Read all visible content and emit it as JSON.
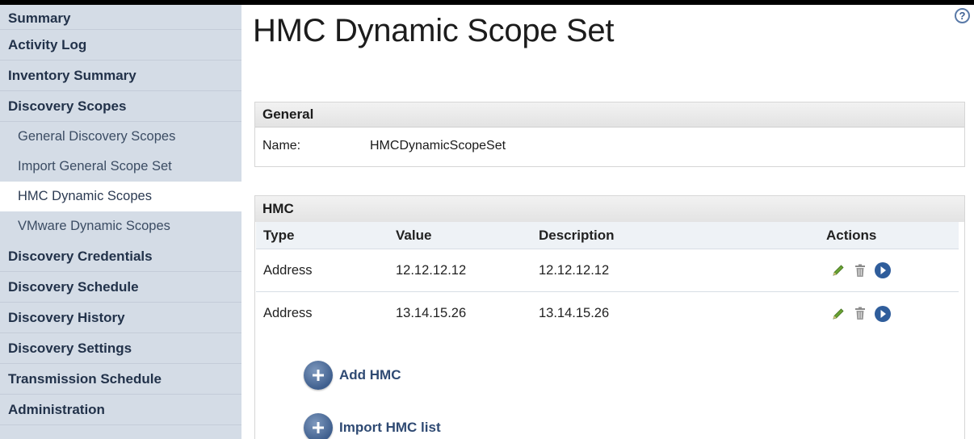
{
  "sidebar": {
    "items": [
      {
        "label": "Summary",
        "type": "section"
      },
      {
        "label": "Activity Log",
        "type": "section"
      },
      {
        "label": "Inventory Summary",
        "type": "section"
      },
      {
        "label": "Discovery Scopes",
        "type": "section"
      },
      {
        "label": "General Discovery Scopes",
        "type": "sub"
      },
      {
        "label": "Import General Scope Set",
        "type": "sub"
      },
      {
        "label": "HMC Dynamic Scopes",
        "type": "sub",
        "active": true
      },
      {
        "label": "VMware Dynamic Scopes",
        "type": "sub"
      },
      {
        "label": "Discovery Credentials",
        "type": "section"
      },
      {
        "label": "Discovery Schedule",
        "type": "section"
      },
      {
        "label": "Discovery History",
        "type": "section"
      },
      {
        "label": "Discovery Settings",
        "type": "section"
      },
      {
        "label": "Transmission Schedule",
        "type": "section"
      },
      {
        "label": "Administration",
        "type": "section"
      }
    ]
  },
  "header": {
    "title": "HMC Dynamic Scope Set",
    "help_icon": "question-circle-icon",
    "help_glyph": "?"
  },
  "general": {
    "heading": "General",
    "name_label": "Name:",
    "name_value": "HMCDynamicScopeSet"
  },
  "hmc": {
    "heading": "HMC",
    "columns": [
      "Type",
      "Value",
      "Description",
      "Actions"
    ],
    "rows": [
      {
        "type": "Address",
        "value": "12.12.12.12",
        "description": "12.12.12.12"
      },
      {
        "type": "Address",
        "value": "13.14.15.26",
        "description": "13.14.15.26"
      }
    ],
    "row_actions": [
      "pencil-icon",
      "trash-icon",
      "arrow-circle-right-icon"
    ],
    "add_label": "Add HMC",
    "import_label": "Import HMC list"
  },
  "colors": {
    "sidebar_bg": "#d4dce6",
    "sidebar_text": "#22324a",
    "accent": "#3f5f8e",
    "edit_green": "#5e9b2f"
  }
}
